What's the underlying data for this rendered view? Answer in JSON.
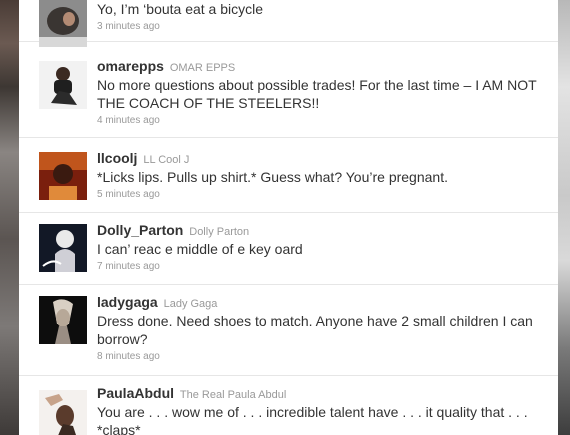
{
  "tweets": [
    {
      "screen_name": "",
      "real_name": "",
      "text": "Yo, I’m ‘bouta eat a bicycle",
      "time": "3 minutes ago",
      "avatar_icon": "user-photo-icon"
    },
    {
      "screen_name": "omarepps",
      "real_name": "OMAR EPPS",
      "text": "No more questions about possible trades! For the last time – I AM NOT THE COACH OF THE STEELERS!!",
      "time": "4 minutes ago",
      "avatar_icon": "user-photo-icon"
    },
    {
      "screen_name": "llcoolj",
      "real_name": "LL Cool J",
      "text": "*Licks lips. Pulls up shirt.* Guess what? You’re pregnant.",
      "time": "5 minutes ago",
      "avatar_icon": "user-photo-icon"
    },
    {
      "screen_name": "Dolly_Parton",
      "real_name": "Dolly Parton",
      "text": "I can’ reac e middle of e key oard",
      "time": "7 minutes ago",
      "avatar_icon": "user-photo-icon"
    },
    {
      "screen_name": "ladygaga",
      "real_name": "Lady Gaga",
      "text": "Dress done. Need shoes to match. Anyone have 2 small children I can borrow?",
      "time": "8 minutes ago",
      "avatar_icon": "user-photo-icon"
    },
    {
      "screen_name": "PaulaAbdul",
      "real_name": "The Real Paula Abdul",
      "text": "You are . . . wow me of . . . incredible talent have . . . it quality that . . . *claps*",
      "time": "",
      "avatar_icon": "user-photo-icon"
    }
  ]
}
